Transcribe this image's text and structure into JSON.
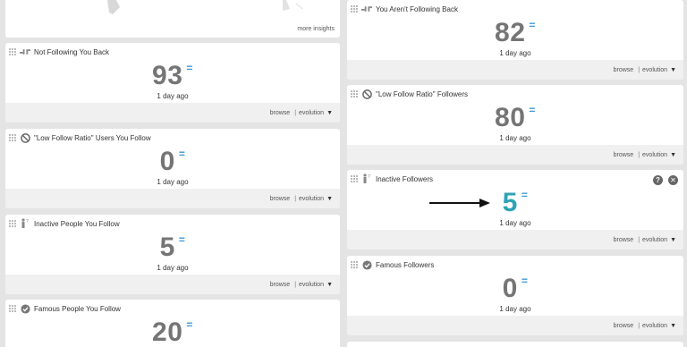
{
  "left": {
    "insights": {
      "more_label": "more insights"
    },
    "cards": [
      {
        "title": "Not Following You Back",
        "icon": "broken-link-person-icon",
        "value": "93",
        "eq": "=",
        "ago": "1 day ago",
        "browse": "browse",
        "sep": "|",
        "evolution": "evolution",
        "caret": "▼"
      },
      {
        "title": "\"Low Follow Ratio\" Users You Follow",
        "icon": "prohibited-icon",
        "value": "0",
        "eq": "=",
        "ago": "1 day ago",
        "browse": "browse",
        "sep": "|",
        "evolution": "evolution",
        "caret": "▼"
      },
      {
        "title": "Inactive People You Follow",
        "icon": "inactive-person-icon",
        "value": "5",
        "eq": "=",
        "ago": "1 day ago",
        "browse": "browse",
        "sep": "|",
        "evolution": "evolution",
        "caret": "▼"
      },
      {
        "title": "Famous People You Follow",
        "icon": "verified-badge-icon",
        "value": "20",
        "eq": "="
      }
    ]
  },
  "right": {
    "cards": [
      {
        "title": "You Aren't Following Back",
        "icon": "broken-link-person-icon",
        "value": "82",
        "eq": "=",
        "ago": "1 day ago",
        "browse": "browse",
        "sep": "|",
        "evolution": "evolution",
        "caret": "▼"
      },
      {
        "title": "\"Low Follow Ratio\" Followers",
        "icon": "prohibited-icon",
        "value": "80",
        "eq": "=",
        "ago": "1 day ago",
        "browse": "browse",
        "sep": "|",
        "evolution": "evolution",
        "caret": "▼"
      },
      {
        "title": "Inactive Followers",
        "icon": "inactive-person-icon",
        "value": "5",
        "eq": "=",
        "ago": "1 day ago",
        "browse": "browse",
        "sep": "|",
        "evolution": "evolution",
        "caret": "▼",
        "help": "?",
        "close": "✕"
      },
      {
        "title": "Famous Followers",
        "icon": "verified-badge-icon",
        "value": "0",
        "eq": "=",
        "ago": "1 day ago",
        "browse": "browse",
        "sep": "|",
        "evolution": "evolution",
        "caret": "▼"
      }
    ]
  },
  "colors": {
    "accent_blue": "#3d9ad6",
    "highlight_teal": "#2fa3b6",
    "number_gray": "#757575",
    "background": "#e4e4e4"
  }
}
